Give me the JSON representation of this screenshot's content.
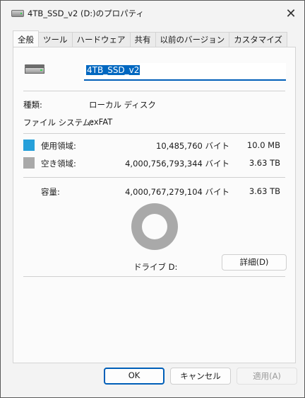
{
  "window": {
    "title": "4TB_SSD_v2 (D:)のプロパティ",
    "close_glyph": "✕",
    "drive_icon": "drive-icon"
  },
  "tabs": [
    {
      "label": "全般",
      "active": true
    },
    {
      "label": "ツール"
    },
    {
      "label": "ハードウェア"
    },
    {
      "label": "共有"
    },
    {
      "label": "以前のバージョン"
    },
    {
      "label": "カスタマイズ"
    }
  ],
  "general": {
    "volume_name": "4TB_SSD_v2",
    "type_label": "種類:",
    "type_value": "ローカル ディスク",
    "fs_label": "ファイル システム:",
    "fs_value": "exFAT",
    "used": {
      "label": "使用領域:",
      "bytes": "10,485,760 バイト",
      "size": "10.0 MB",
      "color": "#26a0da"
    },
    "free": {
      "label": "空き領域:",
      "bytes": "4,000,756,793,344 バイト",
      "size": "3.63 TB",
      "color": "#a9a9a9"
    },
    "capacity": {
      "label": "容量:",
      "bytes": "4,000,767,279,104 バイト",
      "size": "3.63 TB"
    },
    "drive_label": "ドライブ D:",
    "details_button": "詳細(D)"
  },
  "footer": {
    "ok": "OK",
    "cancel": "キャンセル",
    "apply": "適用(A)"
  }
}
